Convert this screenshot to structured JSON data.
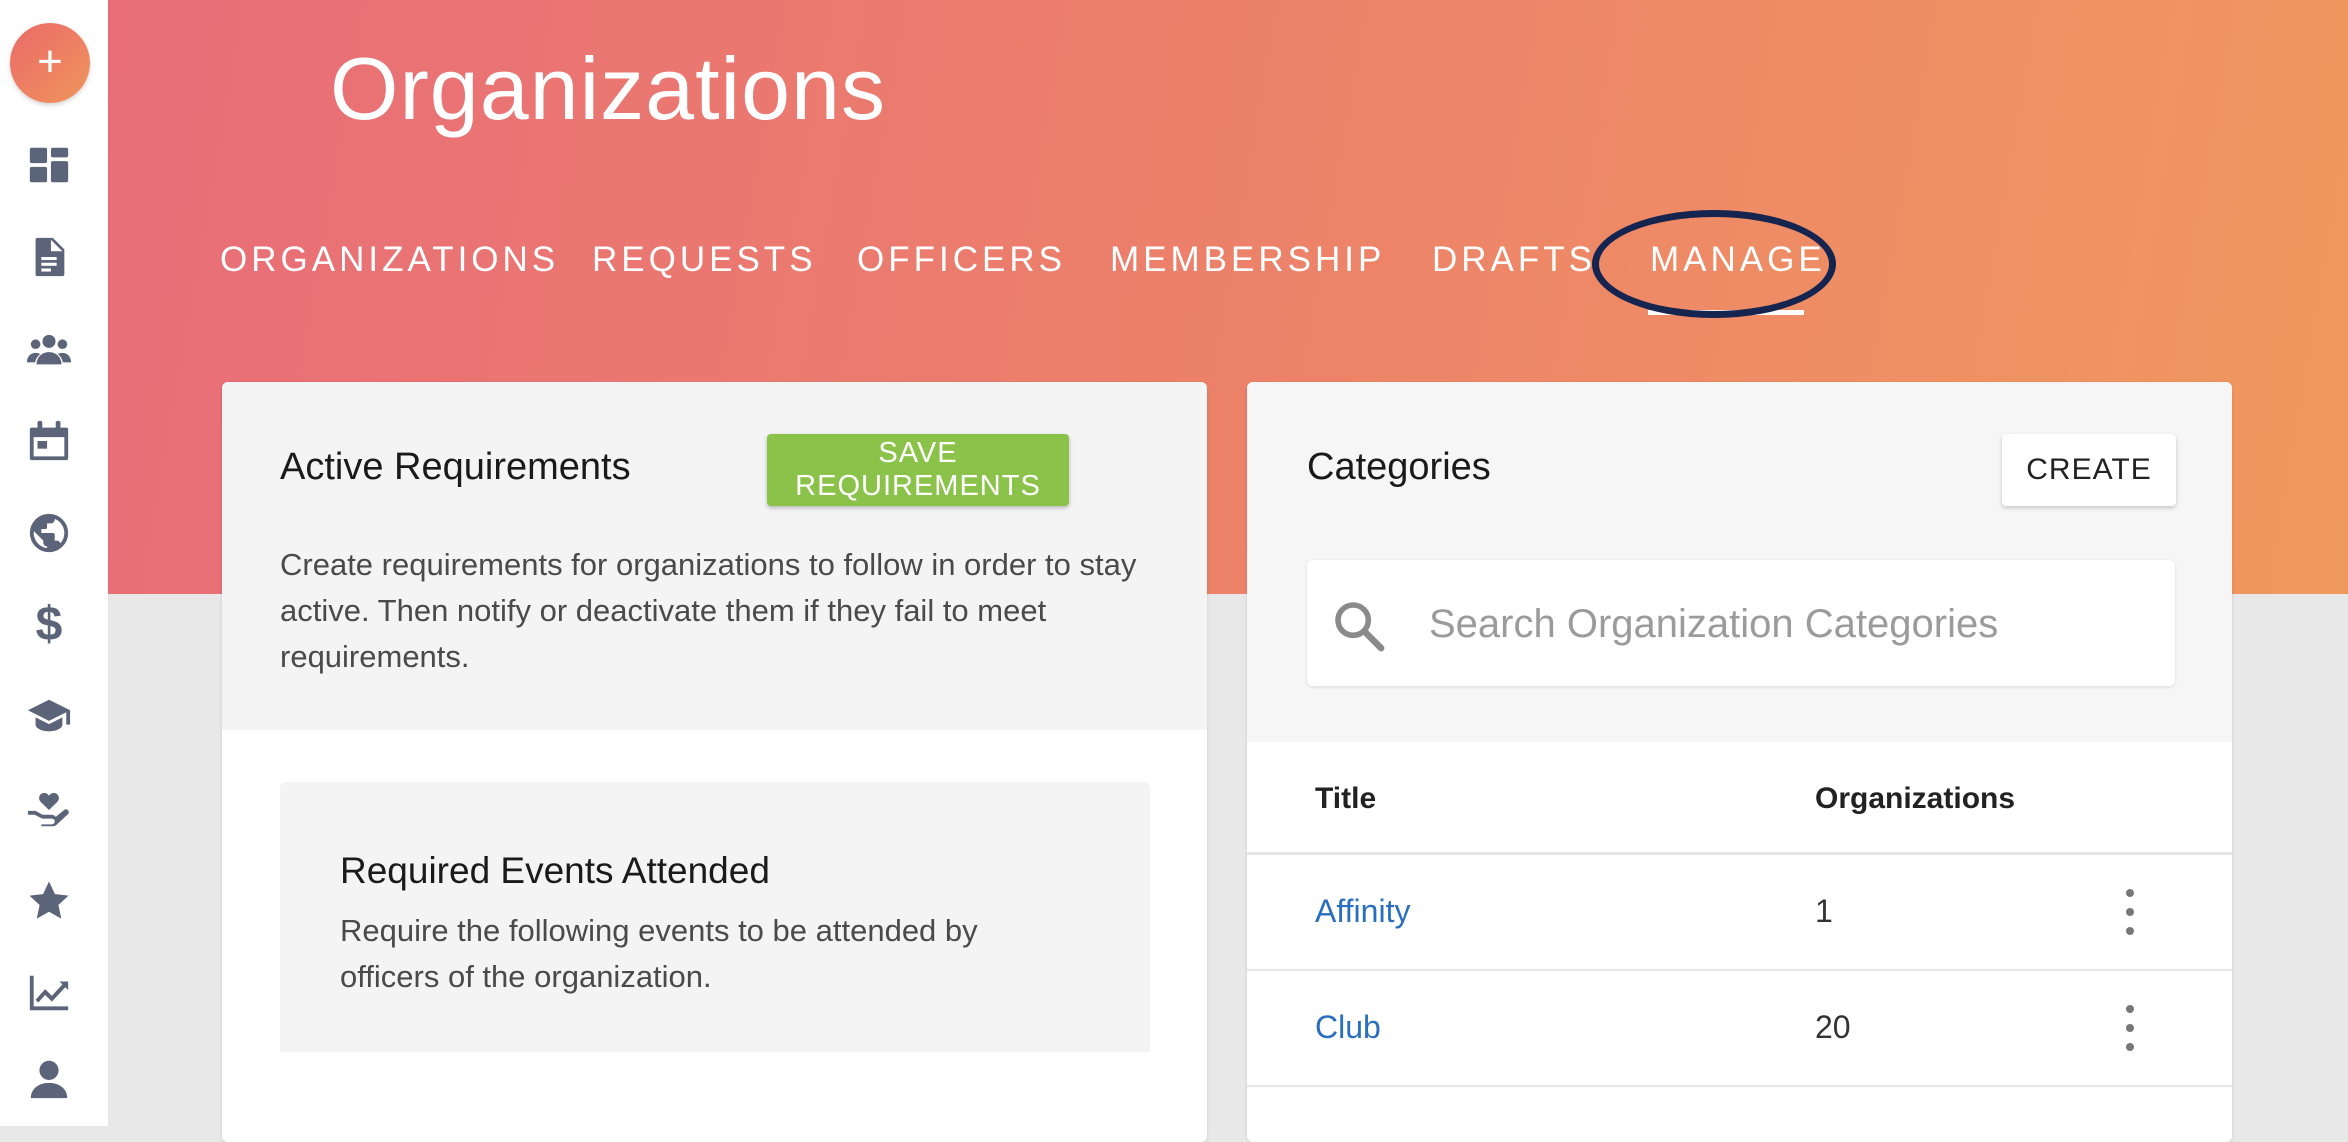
{
  "sidebar": {
    "add_label": "+",
    "items": [
      {
        "icon": "dashboard-icon"
      },
      {
        "icon": "document-icon"
      },
      {
        "icon": "people-icon"
      },
      {
        "icon": "calendar-icon"
      },
      {
        "icon": "globe-icon"
      },
      {
        "icon": "dollar-icon",
        "glyph": "$"
      },
      {
        "icon": "graduation-cap-icon"
      },
      {
        "icon": "heart-hand-icon"
      },
      {
        "icon": "star-icon"
      },
      {
        "icon": "chart-icon"
      },
      {
        "icon": "user-icon"
      }
    ]
  },
  "header": {
    "title": "Organizations",
    "tabs": [
      {
        "label": "ORGANIZATIONS"
      },
      {
        "label": "REQUESTS"
      },
      {
        "label": "OFFICERS"
      },
      {
        "label": "MEMBERSHIP"
      },
      {
        "label": "DRAFTS"
      },
      {
        "label": "MANAGE",
        "active": true
      }
    ]
  },
  "requirements": {
    "title": "Active Requirements",
    "save_label": "SAVE REQUIREMENTS",
    "description": "Create requirements for organizations to follow in order to stay active. Then notify or deactivate them if they fail to meet requirements.",
    "events": {
      "title": "Required Events Attended",
      "description": "Require the following events to be attended by officers of the organization."
    }
  },
  "categories": {
    "title": "Categories",
    "create_label": "CREATE",
    "search_placeholder": "Search Organization Categories",
    "columns": [
      "Title",
      "Organizations"
    ],
    "rows": [
      {
        "title": "Affinity",
        "count": "1"
      },
      {
        "title": "Club",
        "count": "20"
      }
    ]
  },
  "colors": {
    "header_gradient_start": "#e86d78",
    "header_gradient_end": "#f0995f",
    "save_button": "#8bc34a",
    "link": "#2a6ec0",
    "highlight_ring": "#15254f"
  }
}
